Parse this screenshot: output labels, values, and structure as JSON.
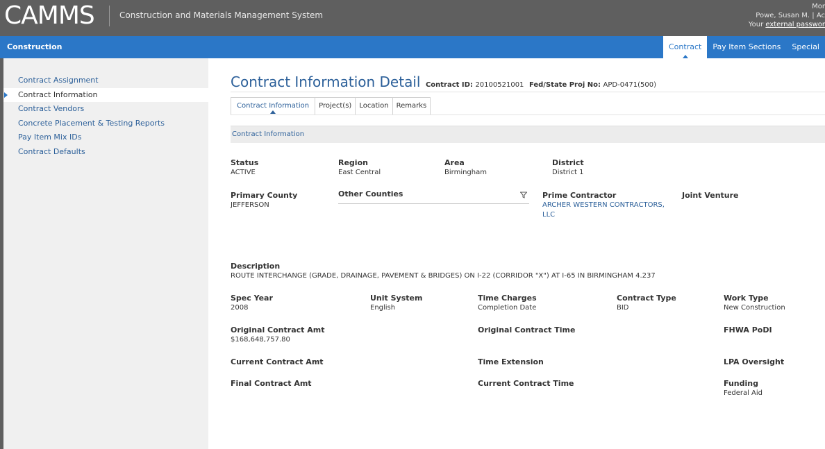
{
  "header": {
    "logo": "CAMMS",
    "app_title": "Construction and Materials Management System",
    "user_line1": "Mor",
    "user_line2": "Powe, Susan M. | Ac",
    "user_line3_prefix": "Your ",
    "user_line3_link": "external passwor"
  },
  "nav": {
    "section": "Construction",
    "tabs": [
      {
        "label": "Contract",
        "active": true
      },
      {
        "label": "Pay Item Sections",
        "active": false
      },
      {
        "label": "Special",
        "active": false
      }
    ]
  },
  "sidebar": {
    "items": [
      {
        "label": "Contract Assignment",
        "active": false
      },
      {
        "label": "Contract Information",
        "active": true
      },
      {
        "label": "Contract Vendors",
        "active": false
      },
      {
        "label": "Concrete Placement & Testing Reports",
        "active": false
      },
      {
        "label": "Pay Item Mix IDs",
        "active": false
      },
      {
        "label": "Contract Defaults",
        "active": false
      }
    ]
  },
  "page": {
    "title": "Contract Information Detail",
    "contract_id_label": "Contract ID:",
    "contract_id": "20100521001",
    "proj_no_label": "Fed/State Proj No:",
    "proj_no": "APD-0471(500)"
  },
  "subtabs": [
    {
      "label": "Contract Information",
      "active": true
    },
    {
      "label": "Project(s)",
      "active": false
    },
    {
      "label": "Location",
      "active": false
    },
    {
      "label": "Remarks",
      "active": false
    }
  ],
  "section_title": "Contract Information",
  "fields": {
    "status": {
      "label": "Status",
      "value": "ACTIVE"
    },
    "region": {
      "label": "Region",
      "value": "East Central"
    },
    "area": {
      "label": "Area",
      "value": "Birmingham"
    },
    "district": {
      "label": "District",
      "value": "District 1"
    },
    "primary_county": {
      "label": "Primary County",
      "value": "JEFFERSON"
    },
    "other_counties": {
      "label": "Other Counties"
    },
    "prime_contractor": {
      "label": "Prime Contractor",
      "value": "ARCHER WESTERN CONTRACTORS, LLC"
    },
    "joint_venture": {
      "label": "Joint Venture"
    },
    "description": {
      "label": "Description",
      "value": "ROUTE INTERCHANGE (GRADE, DRAINAGE, PAVEMENT & BRIDGES) ON I-22 (CORRIDOR \"X\") AT I-65 IN BIRMINGHAM 4.237"
    },
    "spec_year": {
      "label": "Spec Year",
      "value": "2008"
    },
    "unit_system": {
      "label": "Unit System",
      "value": "English"
    },
    "time_charges": {
      "label": "Time Charges",
      "value": "Completion Date"
    },
    "contract_type": {
      "label": "Contract Type",
      "value": "BID"
    },
    "work_type": {
      "label": "Work Type",
      "value": "New Construction"
    },
    "original_contract_amt": {
      "label": "Original Contract Amt",
      "value": "$168,648,757.80"
    },
    "original_contract_time": {
      "label": "Original Contract Time"
    },
    "fhwa_podi": {
      "label": "FHWA PoDI"
    },
    "current_contract_amt": {
      "label": "Current Contract Amt"
    },
    "time_extension": {
      "label": "Time Extension"
    },
    "lpa_oversight": {
      "label": "LPA Oversight"
    },
    "final_contract_amt": {
      "label": "Final Contract Amt"
    },
    "current_contract_time": {
      "label": "Current Contract Time"
    },
    "funding": {
      "label": "Funding",
      "value": "Federal Aid"
    }
  },
  "colors": {
    "header_bg": "#5f5f5f",
    "nav_bg": "#2b77c7",
    "link": "#2b5f99",
    "sidebar_bg": "#f0f0f0"
  }
}
